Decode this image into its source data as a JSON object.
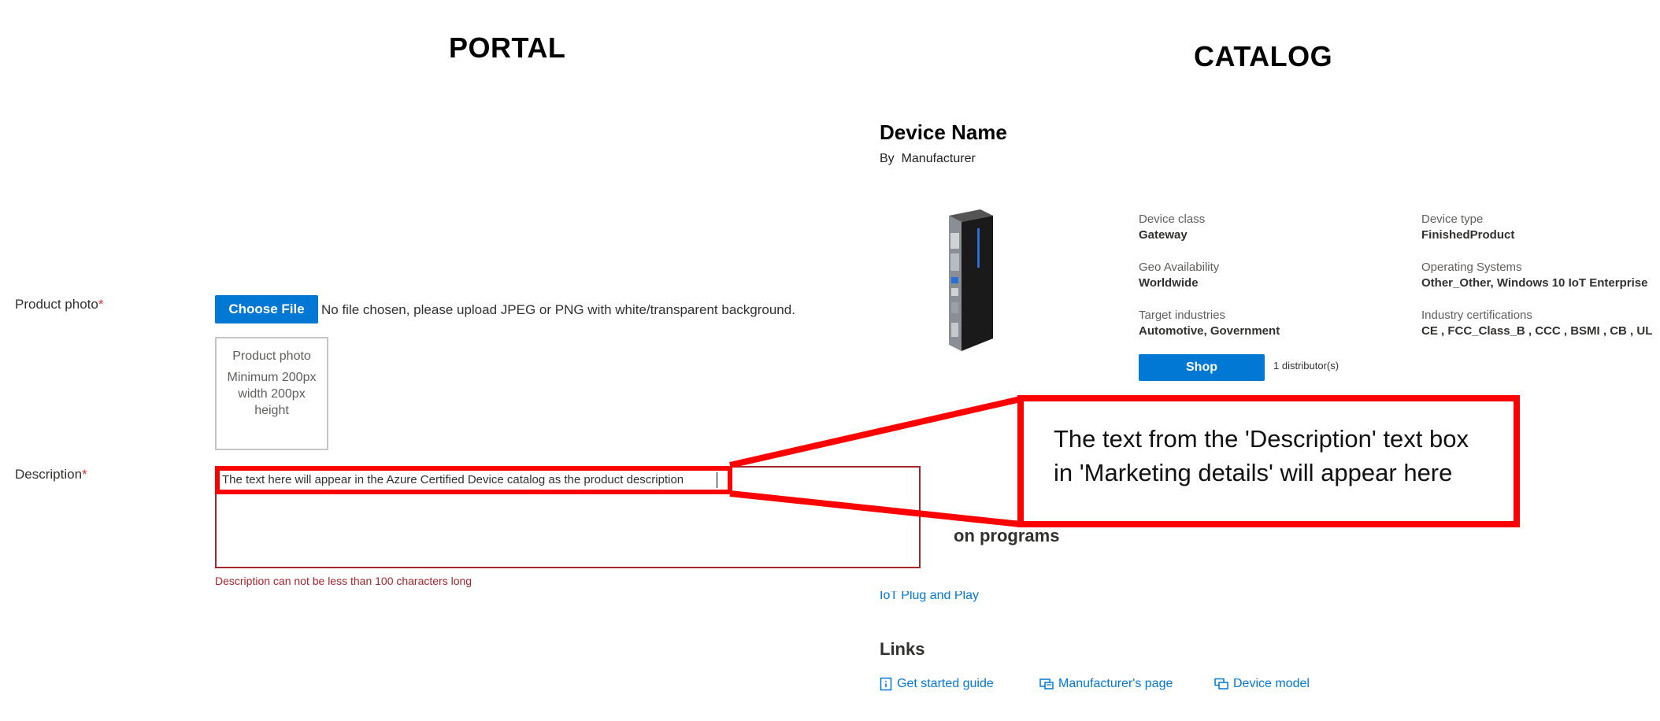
{
  "portal": {
    "heading": "PORTAL",
    "product_photo_label": "Product photo",
    "required_mark": "*",
    "choose_file_label": "Choose File",
    "file_status": "No file chosen, please upload JPEG or PNG with white/transparent background.",
    "photo_box_title": "Product photo",
    "photo_box_hint": "Minimum 200px width 200px height",
    "description_label": "Description",
    "description_value": "The text here will appear in the Azure Certified Device catalog as the product description",
    "description_error": "Description can not be less than 100 characters long"
  },
  "catalog": {
    "heading": "CATALOG",
    "device_name": "Device Name",
    "by_label": "By",
    "manufacturer": "Manufacturer",
    "specs": {
      "device_class_label": "Device class",
      "device_class_value": "Gateway",
      "device_type_label": "Device type",
      "device_type_value": "FinishedProduct",
      "geo_label": "Geo Availability",
      "geo_value": "Worldwide",
      "os_label": "Operating Systems",
      "os_value": "Other_Other, Windows 10 IoT Enterprise",
      "industries_label": "Target industries",
      "industries_value": "Automotive, Government",
      "certs_label": "Industry certifications",
      "certs_value": "CE , FCC_Class_B , CCC , BSMI , CB , UL"
    },
    "shop_label": "Shop",
    "distributors": "1 distributor(s)",
    "programs_heading_partial": "on programs",
    "program_link_partial": "IoT Plug and Play",
    "links_heading": "Links",
    "links": [
      {
        "label": "Get started guide",
        "icon": "info-book-icon"
      },
      {
        "label": "Manufacturer's page",
        "icon": "web-page-icon"
      },
      {
        "label": "Device model",
        "icon": "device-model-icon"
      }
    ]
  },
  "callout_text": "The text from the 'Description' text box in 'Marketing details' will appear here",
  "colors": {
    "accent": "#0078d4",
    "error": "#a4262c",
    "callout": "#ff0000"
  }
}
